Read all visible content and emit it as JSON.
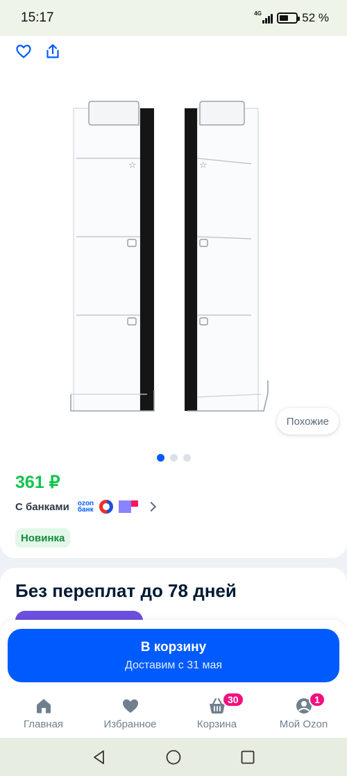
{
  "status_bar": {
    "time": "15:17",
    "network": "4G",
    "battery_level": 0.52,
    "battery_text": "52 %"
  },
  "product": {
    "gallery": {
      "image_count": 3,
      "active_index": 0
    },
    "similar_label": "Похожие",
    "price": "361 ₽",
    "banks_label": "С банками",
    "ozon_bank_line1": "ozon",
    "ozon_bank_line2": "банк",
    "badge_new": "Новинка"
  },
  "installment": {
    "title": "Без переплат до 78 дней"
  },
  "cart_button": {
    "label": "В корзину",
    "delivery": "Доставим с 31 мая"
  },
  "bottom_nav": {
    "items": [
      {
        "label": "Главная",
        "icon": "home-icon"
      },
      {
        "label": "Избранное",
        "icon": "heart-icon"
      },
      {
        "label": "Корзина",
        "icon": "basket-icon",
        "badge": "30"
      },
      {
        "label": "Мой Ozon",
        "icon": "user-icon",
        "badge": "1"
      }
    ]
  },
  "colors": {
    "accent": "#005bff",
    "price_green": "#10c44c",
    "badge_pink": "#f1117e"
  }
}
